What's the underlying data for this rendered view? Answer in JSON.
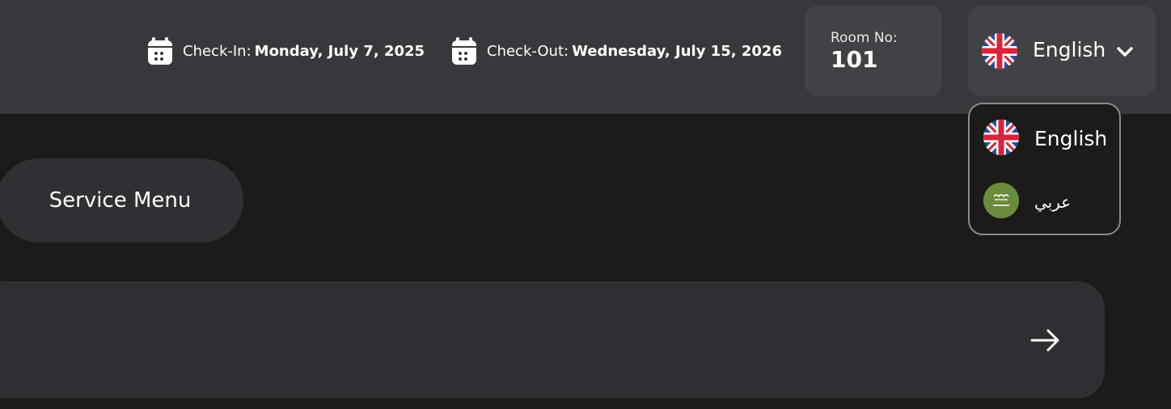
{
  "header": {
    "checkin": {
      "label": "Check-In:",
      "value": "Monday, July 7, 2025",
      "icon": "calendar-icon"
    },
    "checkout": {
      "label": "Check-Out:",
      "value": "Wednesday, July 15, 2026",
      "icon": "calendar-icon"
    },
    "room": {
      "label": "Room No:",
      "number": "101"
    },
    "language": {
      "selected": "English",
      "flag": "uk-flag-icon",
      "chevron": "chevron-down-icon"
    }
  },
  "language_dropdown": {
    "options": [
      {
        "label": "English",
        "flag": "uk-flag-icon"
      },
      {
        "label": "عربي",
        "flag": "saudi-flag-icon"
      }
    ]
  },
  "service_menu": {
    "label": "Service Menu"
  },
  "message_input": {
    "value": "",
    "placeholder": "",
    "send_icon": "arrow-right-icon"
  },
  "colors": {
    "header_bg": "#37383b",
    "page_bg": "#1c1b19",
    "card_bg": "#414245",
    "input_bg": "#2e2f32",
    "saudi_green": "#6b8c3d"
  }
}
